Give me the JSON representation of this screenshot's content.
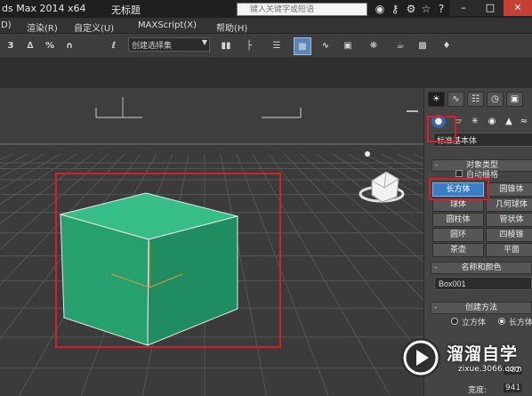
{
  "titlebar": {
    "app_title": "ds Max  2014 x64",
    "doc_title": "无标题",
    "search_placeholder": "键入关键字或短语",
    "icons": [
      "binoculars-icon",
      "key-icon",
      "tools-icon",
      "star-icon",
      "help-icon"
    ]
  },
  "menu": {
    "items": [
      "D)",
      "渲染(R)",
      "自定义(U)",
      "MAXScript(X)",
      "帮助(H)"
    ]
  },
  "toolbar": {
    "snap3_label": "3",
    "snap_angle_label": "∆",
    "snap_percent_label": "%",
    "snap_spinner_label": "∩",
    "edit_named_label": "ℓ",
    "selection_set_value": "创建选择集"
  },
  "command_panel": {
    "category_value": "标准基本体",
    "object_type": {
      "title": "对象类型",
      "autogrid_label": "自动栅格",
      "buttons": [
        "长方体",
        "圆锥体",
        "球体",
        "几何球体",
        "圆柱体",
        "管状体",
        "圆环",
        "四棱锥",
        "茶壶",
        "平面"
      ],
      "selected": "长方体"
    },
    "name_color": {
      "title": "名称和颜色",
      "name_value": "Box001"
    },
    "creation_method": {
      "title": "创建方法",
      "options": [
        "立方体",
        "长方体"
      ],
      "selected": "长方体"
    },
    "params": {
      "value_1": "482",
      "width_label": "宽度:",
      "width_value": "941"
    }
  },
  "viewport": {
    "box_color": "#2aa876",
    "highlight_color": "#d4202a"
  },
  "watermark": {
    "name": "溜溜自学",
    "url": "zixue.3066.com"
  }
}
